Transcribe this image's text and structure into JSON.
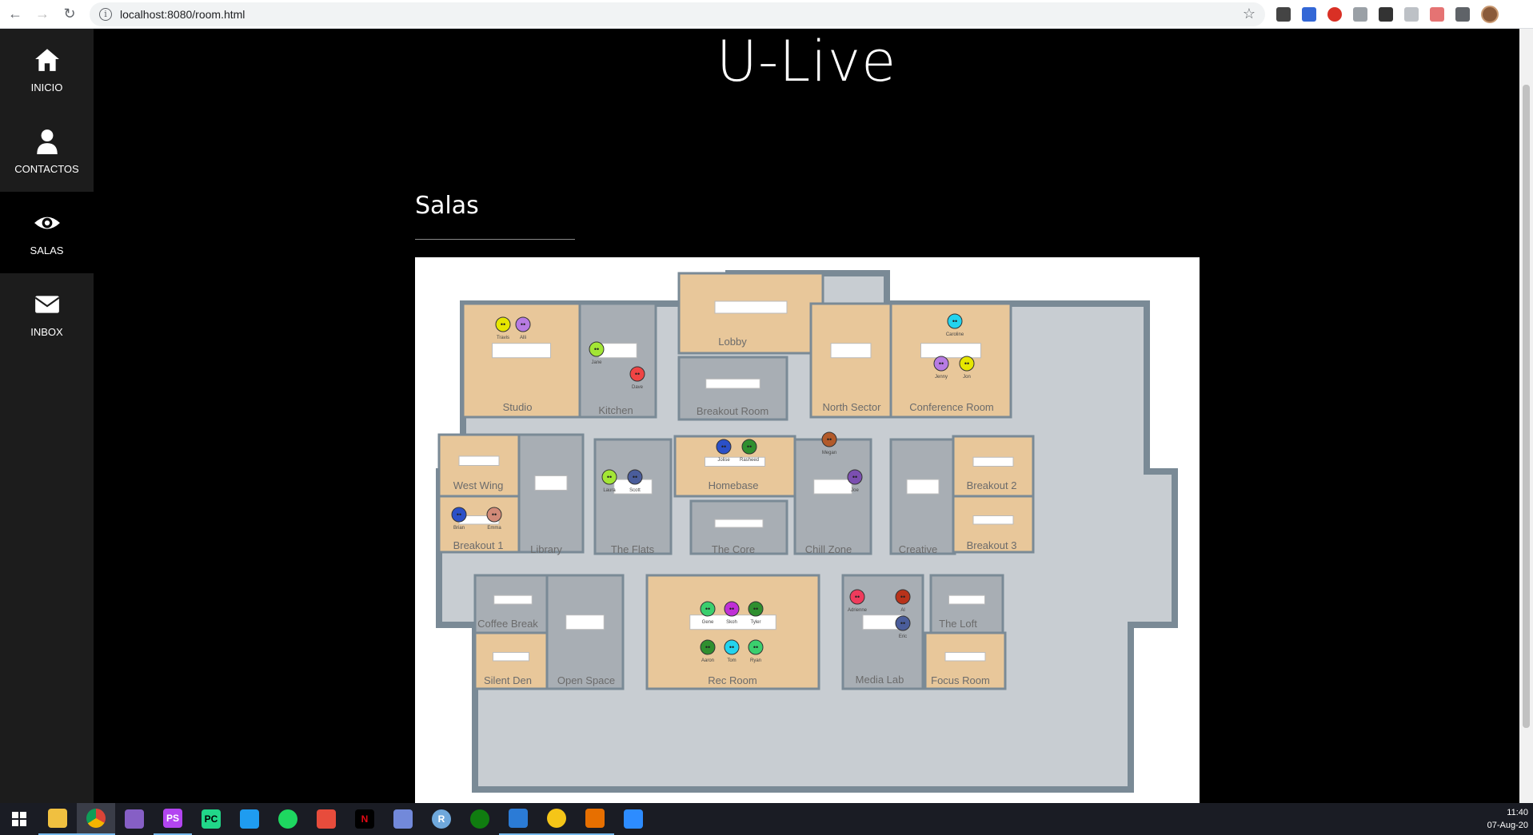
{
  "browser": {
    "url": "localhost:8080/room.html"
  },
  "sidebar": {
    "items": [
      {
        "label": "INICIO",
        "icon": "home-icon"
      },
      {
        "label": "CONTACTOS",
        "icon": "user-icon"
      },
      {
        "label": "SALAS",
        "icon": "eye-icon",
        "active": true
      },
      {
        "label": "INBOX",
        "icon": "envelope-icon"
      }
    ]
  },
  "header": {
    "title": "U-Live"
  },
  "section": {
    "title": "Salas"
  },
  "map": {
    "rooms": [
      "Studio",
      "Kitchen",
      "Lobby",
      "Breakout Room",
      "North Sector",
      "Conference Room",
      "West Wing",
      "Breakout 1",
      "Library",
      "The Flats",
      "Homebase",
      "The Core",
      "Chill Zone",
      "Creative",
      "Breakout 2",
      "Breakout 3",
      "Coffee Break",
      "Silent Den",
      "Open Space",
      "Rec Room",
      "Media Lab",
      "The Loft",
      "Focus Room"
    ],
    "people": [
      "Travis",
      "Alli",
      "Jane",
      "Dave",
      "Caroline",
      "Jenny",
      "Jon",
      "Jolise",
      "Rasheed",
      "Megan",
      "Laura",
      "Scott",
      "Joe",
      "Brian",
      "Emma",
      "Gene",
      "Skoh",
      "Tyler",
      "Aaron",
      "Tom",
      "Ryan",
      "Adrienne",
      "Al",
      "Eric"
    ]
  },
  "taskbar": {
    "apps": [
      "windows-start-icon",
      "file-explorer-icon",
      "chrome-icon",
      "visual-studio-icon",
      "phpstorm-icon",
      "pycharm-icon",
      "vscode-icon",
      "spotify-icon",
      "popcorn-icon",
      "netflix-icon",
      "discord-icon",
      "r-icon",
      "xbox-icon",
      "monitor-icon",
      "oracle-icon",
      "java-icon",
      "zoom-icon"
    ],
    "time": "11:40",
    "date": "07-Aug-20"
  },
  "colors": {
    "sidebar_bg": "#1c1c1c",
    "page_bg": "#000000",
    "floor_wood": "#e8c79a",
    "floor_grey": "#c8cdd2",
    "wall": "#7a8a96"
  }
}
